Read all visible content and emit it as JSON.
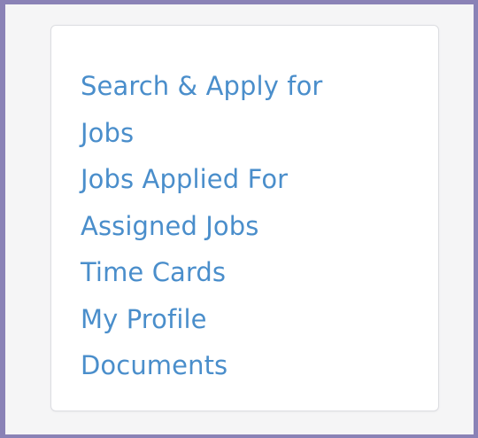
{
  "nav": {
    "items": [
      {
        "label": "Search & Apply for"
      },
      {
        "label": "Jobs"
      },
      {
        "label": "Jobs Applied For"
      },
      {
        "label": "Assigned Jobs"
      },
      {
        "label": "Time Cards"
      },
      {
        "label": "My Profile"
      },
      {
        "label": "Documents"
      }
    ]
  },
  "colors": {
    "frame_border": "#8a82b6",
    "background": "#f5f5f6",
    "card": "#ffffff",
    "link": "#4a8ecb"
  }
}
